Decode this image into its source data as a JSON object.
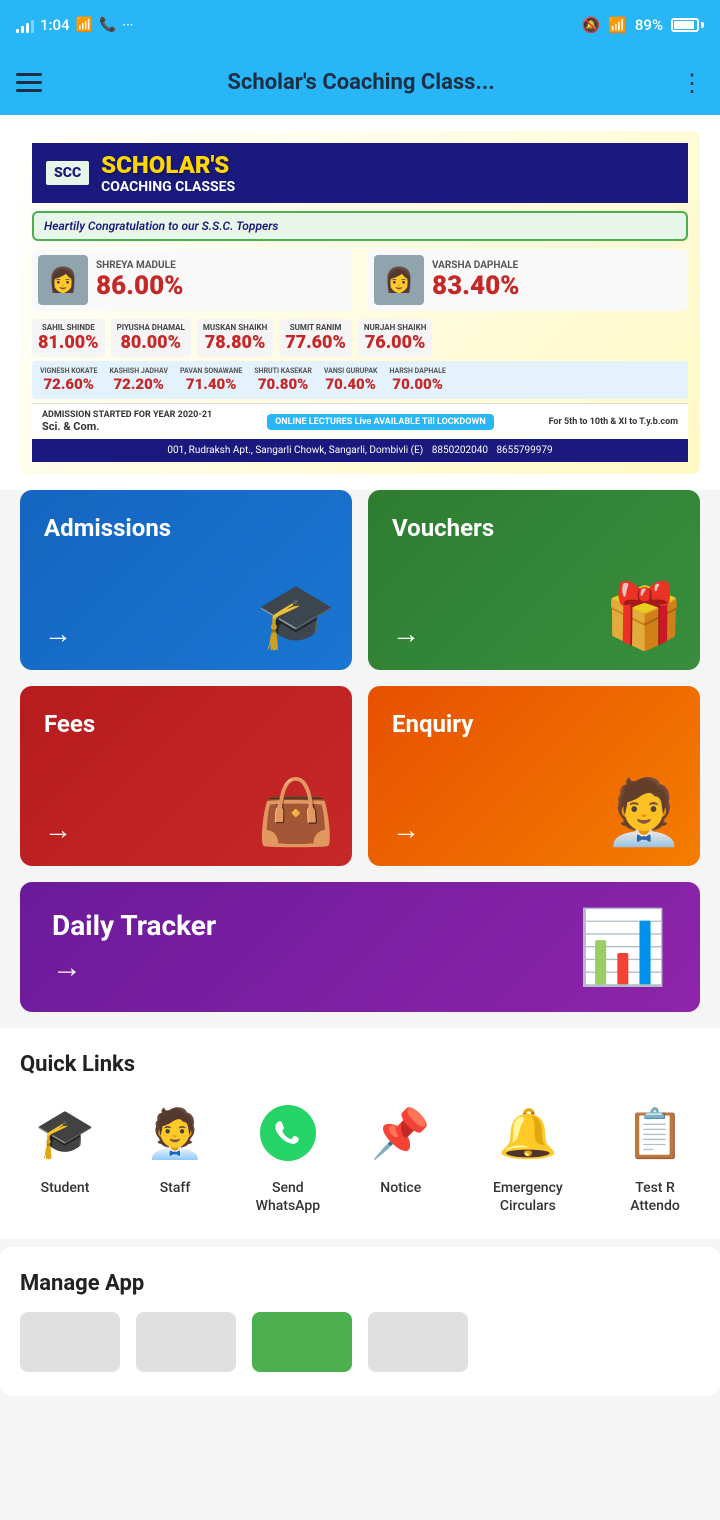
{
  "statusBar": {
    "time": "1:04",
    "battery": "89%",
    "wifi": true
  },
  "appBar": {
    "title": "Scholar's Coaching Class...",
    "menuIcon": "☰",
    "moreIcon": "⋮"
  },
  "banner": {
    "logoText": "SCC",
    "title": "SCHOLAR'S",
    "subtitle": "COACHING CLASSES",
    "congrats": "Heartily Congratulation to our S.S.C. Toppers",
    "toppers": [
      {
        "name": "SHREYA MADULE",
        "score": "86.00%"
      },
      {
        "name": "VARSHA DAPHALE",
        "score": "83.40%"
      }
    ],
    "otherToppers": [
      {
        "name": "SAHIL SHINDE",
        "score": "81.00%"
      },
      {
        "name": "PIYUSHA DHAMAL",
        "score": "80.00%"
      },
      {
        "name": "MUSKAN SHAIKH",
        "score": "78.80%"
      },
      {
        "name": "SUMIT RANIM",
        "score": "77.60%"
      },
      {
        "name": "NURJAH SHAIKH",
        "score": "76.00%"
      }
    ],
    "moreToppers": [
      {
        "name": "VIGNESH KOKATE",
        "score": "72.60%"
      },
      {
        "name": "KASHISH JADHAV",
        "score": "72.20%"
      },
      {
        "name": "PAVAN SONAWANE",
        "score": "71.40%"
      },
      {
        "name": "SHRUTI KASEKAR",
        "score": "70.80%"
      },
      {
        "name": "VANSI GURUPAK",
        "score": "70.40%"
      },
      {
        "name": "HARSH DAPHALE",
        "score": "70.00%"
      }
    ],
    "admission": "ADMISSION STARTED FOR YEAR 2020-21",
    "streams": "Sci. & Com.",
    "online": "ONLINE LECTURES Live AVAILABLE Till LOCKDOWN",
    "classes": "For 5th to 10th & XI to T.y.b.com",
    "address": "001, Rudraksh Apt., Sangarli Chowk, Sangarli, Dombivli (E)",
    "phone1": "8850202040",
    "phone2": "8655799979"
  },
  "cards": {
    "admissions": {
      "label": "Admissions",
      "arrow": "→",
      "icon": "🎓"
    },
    "vouchers": {
      "label": "Vouchers",
      "arrow": "→",
      "icon": "🎁"
    },
    "fees": {
      "label": "Fees",
      "arrow": "→",
      "icon": "👜"
    },
    "enquiry": {
      "label": "Enquiry",
      "arrow": "→",
      "icon": "🧑‍💼"
    },
    "dailyTracker": {
      "label": "Daily Tracker",
      "arrow": "→",
      "icon": "📊"
    }
  },
  "quickLinks": {
    "title": "Quick Links",
    "items": [
      {
        "label": "Student",
        "icon": "🎓"
      },
      {
        "label": "Staff",
        "icon": "🧑‍💼"
      },
      {
        "label": "Send WhatsApp",
        "icon": "💬"
      },
      {
        "label": "Notice",
        "icon": "📌"
      },
      {
        "label": "Emergency Circulars",
        "icon": "🔔"
      },
      {
        "label": "Test R Attendo",
        "icon": "📋"
      }
    ]
  },
  "manageApp": {
    "title": "Manage App"
  }
}
